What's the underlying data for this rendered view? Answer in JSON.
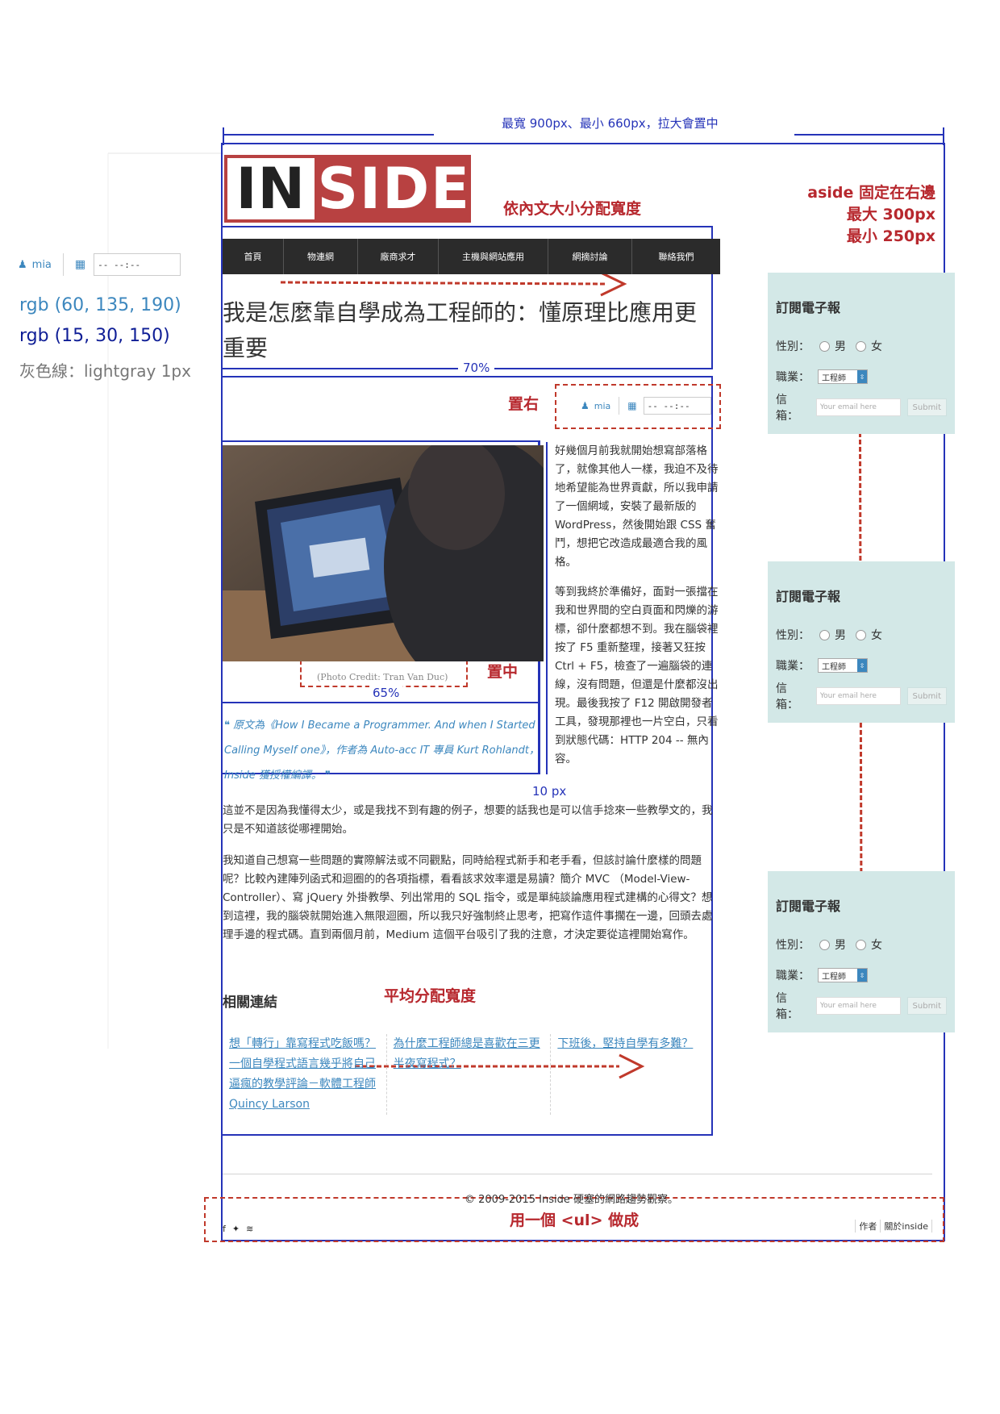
{
  "annotations": {
    "top_width": "最寬 900px、最小 660px，拉大會置中",
    "logo_width": "依內文大小分配寬度",
    "aside_line1": "aside 固定在右邊",
    "aside_line2": "最大 300px",
    "aside_line3": "最小 250px",
    "width_70": "70%",
    "align_right": "置右",
    "align_center": "置中",
    "width_65": "65%",
    "gap_10": "10 px",
    "equal_width": "平均分配寬度",
    "footer_ul": "用一個 <ul> 做成"
  },
  "legend": {
    "user": "mia",
    "date_value": "-- --:--",
    "rgb_light": "rgb (60, 135, 190)",
    "rgb_dark": "rgb (15, 30, 150)",
    "gray_line": "灰色線：lightgray 1px"
  },
  "colors": {
    "link_blue": "#3c87be",
    "dark_blue": "#0f1e96",
    "logo_red": "#b84141",
    "aside_bg": "#d3e8e7",
    "annotation_red": "#c0392b",
    "annotation_blue": "#2533b8"
  },
  "logo": {
    "part1": "IN",
    "part2": "SIDE"
  },
  "nav": [
    "首頁",
    "物連網",
    "廠商求才",
    "主機與網站應用",
    "網摘討論",
    "聯絡我們"
  ],
  "article": {
    "title": "我是怎麼靠自學成為工程師的：懂原理比應用更重要",
    "meta_user": "mia",
    "meta_date": "-- --:--",
    "caption": "(Photo Credit: Tran Van Duc)",
    "quote": "❝ 原文為《How I Became a Programmer. And when I Started Calling Myself one》，作者為 Auto-acc IT 專員 Kurt Rohlandt，Inside 獲授權編譯。 ❞",
    "side_p1": "好幾個月前我就開始想寫部落格了，就像其他人一樣，我迫不及待地希望能為世界貢獻，所以我申請了一個網域，安裝了最新版的 WordPress，然後開始跟 CSS 奮鬥，想把它改造成最適合我的風格。",
    "side_p2": "等到我終於準備好，面對一張擋在我和世界間的空白頁面和閃爍的游標，卻什麼都想不到。我在腦袋裡按了 F5 重新整理，接著又狂按 Ctrl + F5，檢查了一遍腦袋的連線，沒有問題，但還是什麼都沒出現。最後我按了 F12 開啟開發者工具，發現那裡也一片空白，只看到狀態代碼：HTTP 204 -- 無內容。",
    "body_p1": "這並不是因為我懂得太少，或是我找不到有趣的例子，想要的話我也是可以信手捻來一些教學文的，我只是不知道該從哪裡開始。",
    "body_p2": "我知道自己想寫一些問題的實際解法或不同觀點，同時給程式新手和老手看，但該討論什麼樣的問題呢？比較內建陣列函式和迴圈的的各項指標，看看該求效率還是易讀？簡介 MVC （Model-View-Controller）、寫 jQuery 外掛教學、列出常用的 SQL 指令，或是單純談論應用程式建構的心得文？想到這裡，我的腦袋就開始進入無限迴圈，所以我只好強制終止思考，把寫作這件事擱在一邊，回頭去處理手邊的程式碼。直到兩個月前，Medium 這個平台吸引了我的注意，才決定要從這裡開始寫作。"
  },
  "related": {
    "title": "相關連結",
    "items": [
      "想「轉行」靠寫程式吃飯嗎？一個自學程式語言幾乎將自己逼瘋的教學評論－軟體工程師 Quincy Larson",
      "為什麼工程師總是喜歡在三更半夜寫程式？",
      "下班後，堅持自學有多難？"
    ]
  },
  "aside": {
    "title": "訂閱電子報",
    "gender_label": "性別：",
    "male": "男",
    "female": "女",
    "job_label": "職業：",
    "job_value": "工程師",
    "email_label": "信箱：",
    "email_placeholder": "Your email here",
    "submit": "Submit"
  },
  "footer": {
    "copyright": "© 2009-2015 Inside 硬塞的網路趨勢觀察。",
    "social_icons": [
      "facebook-icon",
      "twitter-icon",
      "rss-icon"
    ],
    "links": [
      "作者",
      "關於inside"
    ]
  }
}
